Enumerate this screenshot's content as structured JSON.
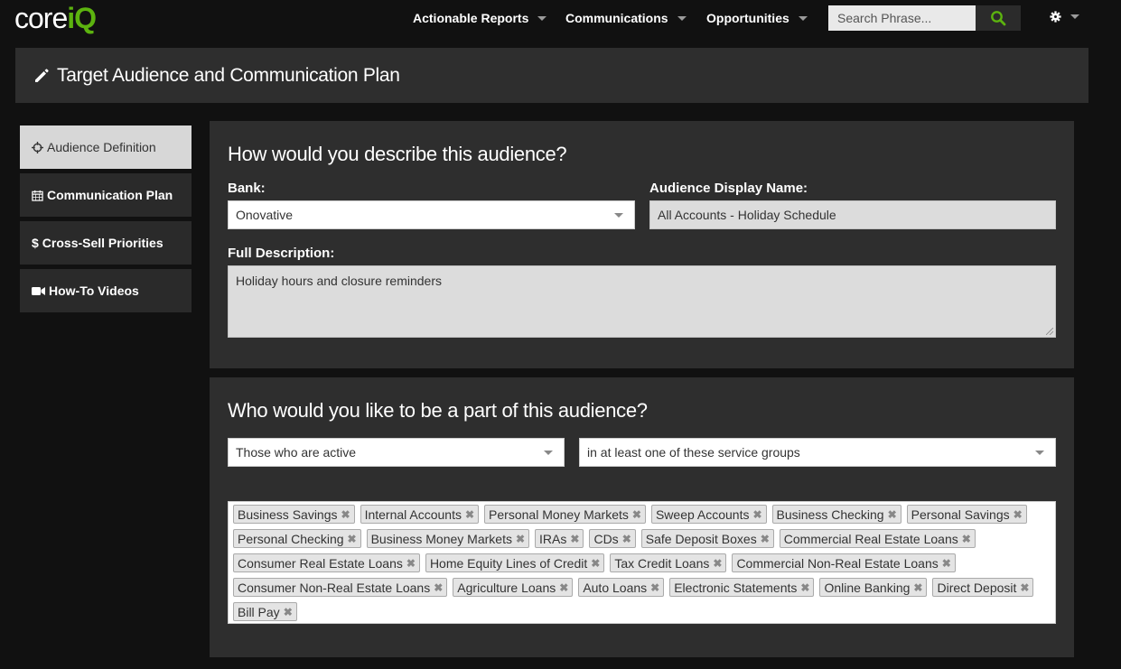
{
  "logo": {
    "core": "core",
    "iq": "iQ"
  },
  "nav": {
    "items": [
      {
        "label": "Actionable Reports"
      },
      {
        "label": "Communications"
      },
      {
        "label": "Opportunities"
      }
    ],
    "search_placeholder": "Search Phrase..."
  },
  "page_title": "Target Audience and Communication Plan",
  "sidebar": {
    "items": [
      {
        "label": "Audience Definition",
        "icon": "crosshairs-icon",
        "active": true
      },
      {
        "label": "Communication Plan",
        "icon": "calendar-icon",
        "active": false
      },
      {
        "label": "Cross-Sell Priorities",
        "icon": "dollar-icon",
        "active": false
      },
      {
        "label": "How-To Videos",
        "icon": "video-camera-icon",
        "active": false
      }
    ]
  },
  "describe": {
    "heading": "How would you describe this audience?",
    "bank_label": "Bank:",
    "bank_value": "Onovative",
    "display_name_label": "Audience Display Name:",
    "display_name_value": "All Accounts - Holiday Schedule",
    "description_label": "Full Description:",
    "description_value": "Holiday hours and closure reminders"
  },
  "membership": {
    "heading": "Who would you like to be a part of this audience?",
    "status_value": "Those who are active",
    "scope_value": "in at least one of these service groups",
    "tags": [
      "Business Savings",
      "Internal Accounts",
      "Personal Money Markets",
      "Sweep Accounts",
      "Business Checking",
      "Personal Savings",
      "Personal Checking",
      "Business Money Markets",
      "IRAs",
      "CDs",
      "Safe Deposit Boxes",
      "Commercial Real Estate Loans",
      "Consumer Real Estate Loans",
      "Home Equity Lines of Credit",
      "Tax Credit Loans",
      "Commercial Non-Real Estate Loans",
      "Consumer Non-Real Estate Loans",
      "Agriculture Loans",
      "Auto Loans",
      "Electronic Statements",
      "Online Banking",
      "Direct Deposit",
      "Bill Pay"
    ]
  },
  "colors": {
    "accent": "#5cb30f",
    "panel": "#2e2e2e",
    "background": "#111111"
  }
}
